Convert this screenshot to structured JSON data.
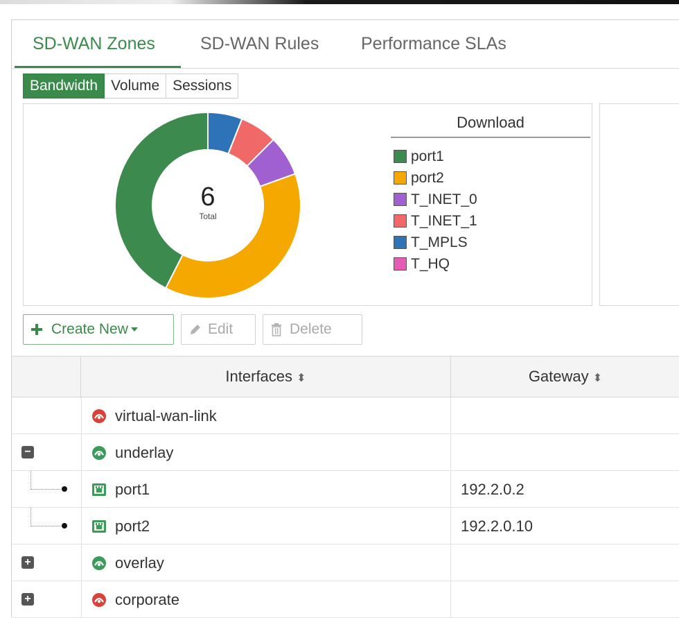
{
  "tabs": [
    {
      "label": "SD-WAN Zones",
      "active": true
    },
    {
      "label": "SD-WAN Rules",
      "active": false
    },
    {
      "label": "Performance SLAs",
      "active": false
    }
  ],
  "view_toggle": [
    "Bandwidth",
    "Volume",
    "Sessions"
  ],
  "chart": {
    "center_value": "6",
    "center_label": "Total",
    "legend_title": "Download",
    "legend": [
      {
        "label": "port1",
        "color": "#3c8a4e"
      },
      {
        "label": "port2",
        "color": "#f5a800"
      },
      {
        "label": "T_INET_0",
        "color": "#a160d0"
      },
      {
        "label": "T_INET_1",
        "color": "#f06868"
      },
      {
        "label": "T_MPLS",
        "color": "#2e72b8"
      },
      {
        "label": "T_HQ",
        "color": "#e45cb4"
      }
    ]
  },
  "chart_data": {
    "type": "pie",
    "categories": [
      "T_MPLS",
      "T_INET_1",
      "T_INET_0",
      "port2",
      "port1"
    ],
    "values": [
      6,
      6.5,
      7,
      38,
      42.5
    ],
    "colors": [
      "#2e72b8",
      "#f06868",
      "#a160d0",
      "#f5a800",
      "#3c8a4e"
    ]
  },
  "actions": {
    "create": "Create New",
    "edit": "Edit",
    "delete": "Delete"
  },
  "table": {
    "headers": {
      "interfaces": "Interfaces",
      "gateway": "Gateway"
    },
    "rows": [
      {
        "name": "virtual-wan-link",
        "gateway": "",
        "icon": "zone-red"
      },
      {
        "name": "underlay",
        "gateway": "",
        "icon": "zone-green"
      },
      {
        "name": "port1",
        "gateway": "192.2.0.2",
        "icon": "port"
      },
      {
        "name": "port2",
        "gateway": "192.2.0.10",
        "icon": "port"
      },
      {
        "name": "overlay",
        "gateway": "",
        "icon": "zone-green"
      },
      {
        "name": "corporate",
        "gateway": "",
        "icon": "zone-red"
      }
    ]
  }
}
